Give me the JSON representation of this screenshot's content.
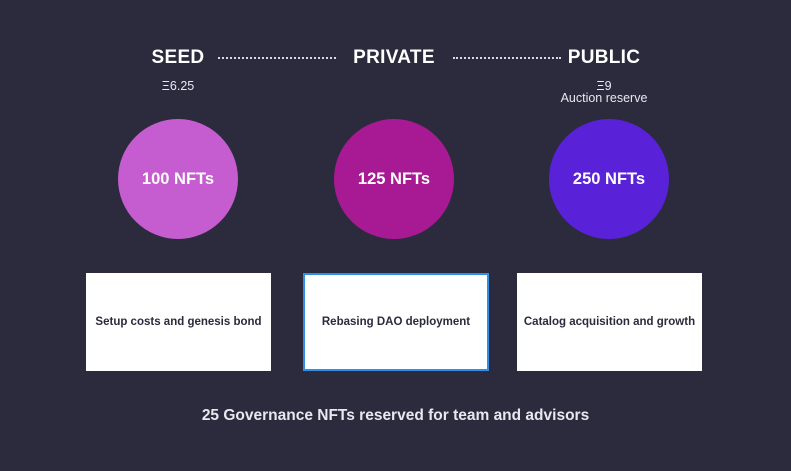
{
  "stages": [
    {
      "name": "SEED",
      "price": "Ξ6.25",
      "note": "",
      "nfts": "100 NFTs",
      "use": "Setup costs and genesis bond",
      "color": "#c55ccf"
    },
    {
      "name": "PRIVATE",
      "price": "",
      "note": "",
      "nfts": "125 NFTs",
      "use": "Rebasing DAO deployment",
      "color": "#a81a94"
    },
    {
      "name": "PUBLIC",
      "price": "Ξ9",
      "note": "Auction reserve",
      "nfts": "250 NFTs",
      "use": "Catalog acquisition and growth",
      "color": "#5a22d8"
    }
  ],
  "footer": "25 Governance NFTs reserved for team and advisors",
  "colors": {
    "background": "#2b2b3d",
    "selected_border": "#2d8fe6"
  }
}
